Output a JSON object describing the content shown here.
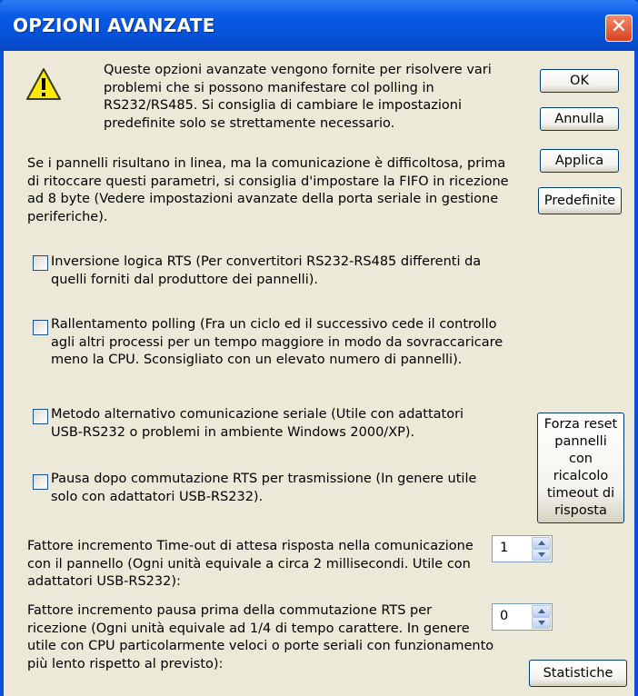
{
  "window": {
    "title": "OPZIONI AVANZATE",
    "close_label": "✕"
  },
  "warning": {
    "icon": "warning-icon",
    "text": "Queste opzioni avanzate vengono fornite per risolvere vari problemi che si possono manifestare col polling in RS232/RS485. Si consiglia di cambiare le impostazioni predefinite solo se strettamente necessario."
  },
  "info_text": "Se i pannelli risultano in linea, ma la comunicazione è difficoltosa, prima di ritoccare questi parametri, si consiglia d'impostare la FIFO in ricezione ad 8 byte (Vedere impostazioni avanzate della porta seriale in gestione periferiche).",
  "buttons": {
    "ok": "OK",
    "annulla": "Annulla",
    "applica": "Applica",
    "predefinite": "Predefinite",
    "forza_reset": "Forza reset pannelli con ricalcolo timeout di risposta",
    "statistiche": "Statistiche"
  },
  "options": [
    {
      "label": "Inversione logica RTS (Per convertitori RS232-RS485 differenti da quelli forniti dal produttore dei pannelli).",
      "checked": false
    },
    {
      "label": "Rallentamento polling (Fra un ciclo ed il successivo cede il controllo agli altri processi per un tempo maggiore in modo da sovraccaricare meno la CPU. Sconsigliato con un elevato numero di pannelli).",
      "checked": false
    },
    {
      "label": "Metodo alternativo comunicazione seriale (Utile con adattatori USB-RS232 o problemi in ambiente Windows 2000/XP).",
      "checked": false
    },
    {
      "label": "Pausa dopo commutazione RTS per trasmissione (In genere utile solo con adattatori USB-RS232).",
      "checked": false
    }
  ],
  "spinners": [
    {
      "label": "Fattore incremento Time-out di attesa risposta nella comunicazione con il pannello (Ogni unità equivale a circa 2 millisecondi. Utile con adattatori USB-RS232):",
      "value": "1"
    },
    {
      "label": "Fattore incremento pausa prima della commutazione RTS per ricezione (Ogni unità equivale ad 1/4 di tempo carattere. In genere utile con CPU particolarmente veloci o porte seriali con funzionamento più lento rispetto al previsto):",
      "value": "0"
    }
  ]
}
